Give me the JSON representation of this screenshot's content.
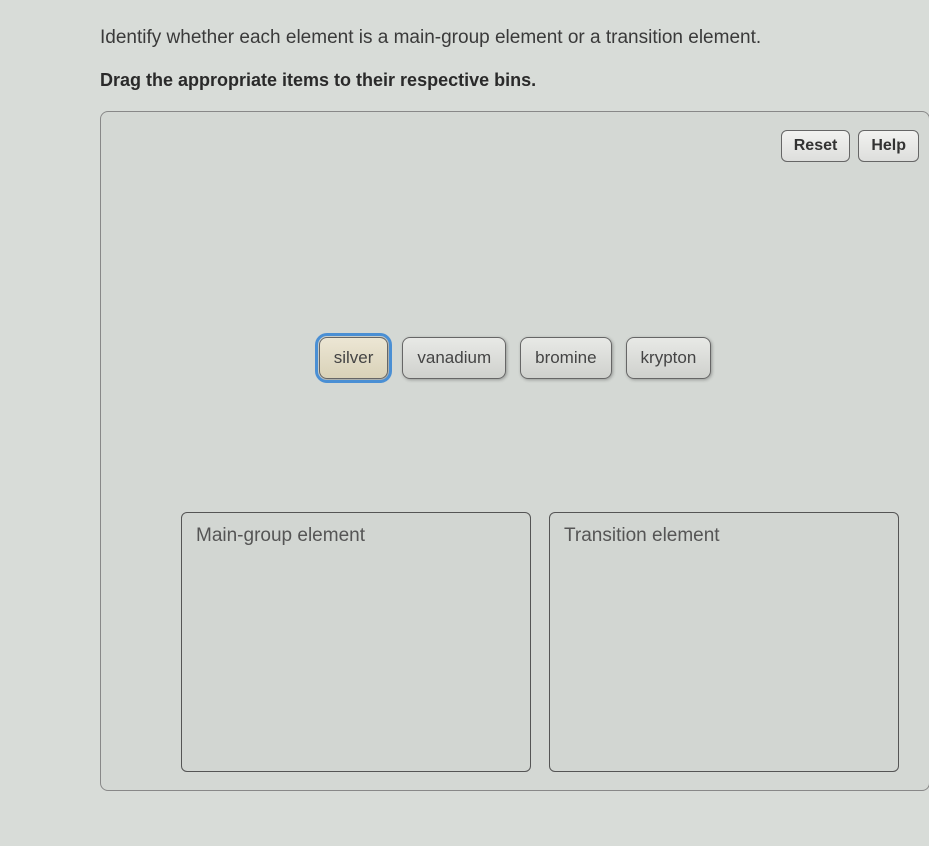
{
  "question": "Identify whether each element is a main-group element or a transition element.",
  "instruction": "Drag the appropriate items to their respective bins.",
  "buttons": {
    "reset": "Reset",
    "help": "Help"
  },
  "items": [
    {
      "label": "silver",
      "selected": true
    },
    {
      "label": "vanadium",
      "selected": false
    },
    {
      "label": "bromine",
      "selected": false
    },
    {
      "label": "krypton",
      "selected": false
    }
  ],
  "bins": [
    {
      "label": "Main-group element"
    },
    {
      "label": "Transition element"
    }
  ]
}
